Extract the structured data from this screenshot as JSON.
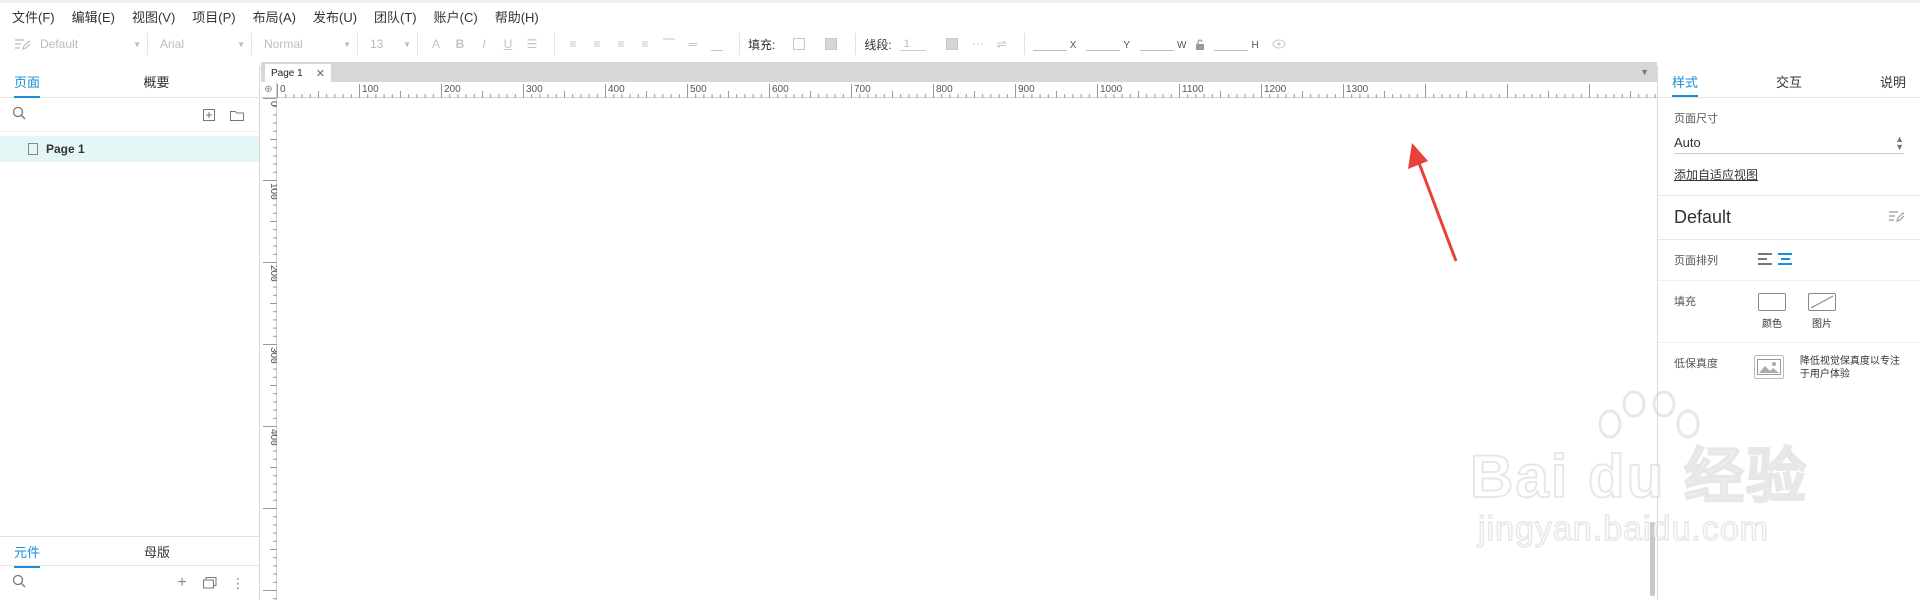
{
  "menu": [
    "文件(F)",
    "编辑(E)",
    "视图(V)",
    "项目(P)",
    "布局(A)",
    "发布(U)",
    "团队(T)",
    "账户(C)",
    "帮助(H)"
  ],
  "toolbar": {
    "style_select": "Default",
    "font_select": "Arial",
    "weight_select": "Normal",
    "size_select": "13",
    "fill_label": "填充:",
    "stroke_label": "线段:",
    "stroke_value": "1",
    "x_label": "X",
    "y_label": "Y",
    "w_label": "W",
    "h_label": "H"
  },
  "left_panel": {
    "tabs": [
      "页面",
      "概要"
    ],
    "active_tab": "页面",
    "pages": [
      "Page 1"
    ],
    "bottom_tabs": [
      "元件",
      "母版"
    ],
    "bottom_active": "元件"
  },
  "document": {
    "tab_label": "Page 1",
    "h_ruler": [
      "0",
      "100",
      "200",
      "300",
      "400",
      "500",
      "600",
      "700",
      "800",
      "900",
      "1000",
      "1100",
      "1200",
      "1300"
    ],
    "v_ruler": [
      "0",
      "100",
      "200",
      "300",
      "400"
    ]
  },
  "right_panel": {
    "tabs": [
      "样式",
      "交互",
      "说明"
    ],
    "active_tab": "样式",
    "page_size_label": "页面尺寸",
    "page_size_value": "Auto",
    "adaptive_link": "添加自适应视图",
    "style_name": "Default",
    "arrangement_label": "页面排列",
    "fill_label": "填充",
    "fill_color": "颜色",
    "fill_image": "图片",
    "lowfi_label": "低保真度",
    "lowfi_desc": "降低视觉保真度以专注于用户体验"
  },
  "watermark": {
    "brand": "Bai du 经验",
    "url": "jingyan.baidu.com"
  },
  "colors": {
    "accent": "#1a8fd8",
    "arrow": "#e8413a",
    "selected_row": "#e5f6f6"
  }
}
